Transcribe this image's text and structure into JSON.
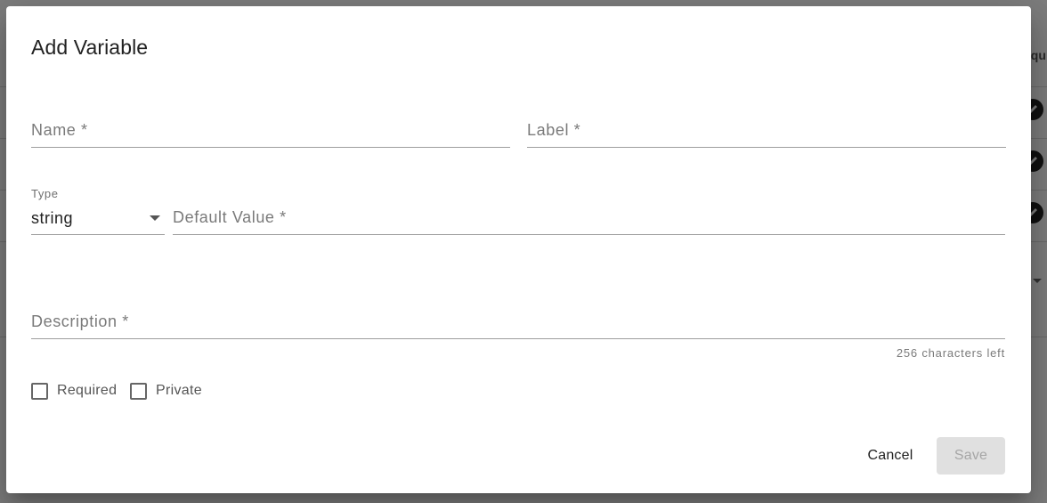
{
  "background": {
    "column_header_fragment": "equ"
  },
  "dialog": {
    "title": "Add Variable",
    "fields": {
      "name": {
        "placeholder": "Name *",
        "value": ""
      },
      "label": {
        "placeholder": "Label *",
        "value": ""
      },
      "type": {
        "label": "Type",
        "selected": "string"
      },
      "default_value": {
        "placeholder": "Default Value *",
        "value": ""
      },
      "description": {
        "placeholder": "Description *",
        "value": "",
        "counter": "256 characters left"
      }
    },
    "checkboxes": {
      "required": {
        "label": "Required",
        "checked": false
      },
      "private": {
        "label": "Private",
        "checked": false
      }
    },
    "actions": {
      "cancel_label": "Cancel",
      "save_label": "Save",
      "save_disabled": true
    }
  },
  "colors": {
    "backdrop": "#7d7d7d",
    "dialog_bg": "#ffffff",
    "underline": "#9e9e9e",
    "disabled_button_bg": "#e0e0e0",
    "disabled_button_text": "#a6a6a6"
  }
}
